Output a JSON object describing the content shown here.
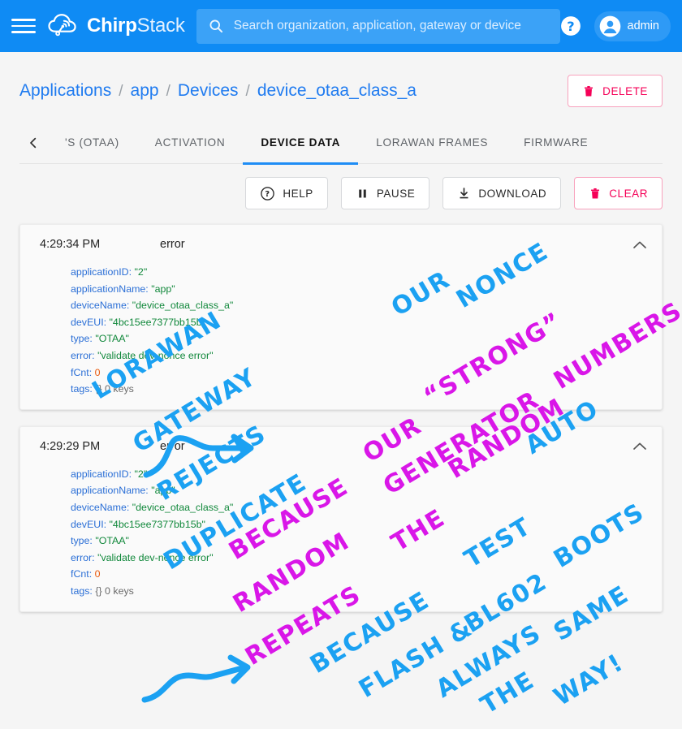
{
  "header": {
    "menu_icon": "hamburger-icon",
    "brand_bold": "Chirp",
    "brand_thin": "Stack",
    "logo_icon": "chirpstack-cloud-icon",
    "search_icon": "search-icon",
    "search_value": "",
    "search_placeholder": "Search organization, application, gateway or device",
    "help_icon": "help-circle-icon",
    "avatar_icon": "account-circle-icon",
    "user_name": "admin",
    "bg_color": "#0f8bf4"
  },
  "breadcrumb": {
    "items": [
      {
        "label": "Applications"
      },
      {
        "label": "app"
      },
      {
        "label": "Devices"
      },
      {
        "label": "device_otaa_class_a"
      }
    ],
    "separator": "/",
    "link_color": "#1f7bf0"
  },
  "delete_button": {
    "label": "DELETE",
    "icon": "trash-icon",
    "color": "#f50057"
  },
  "tabs": {
    "back_icon": "chevron-left-icon",
    "items": [
      {
        "label": "'S (OTAA)",
        "active": false
      },
      {
        "label": "ACTIVATION",
        "active": false
      },
      {
        "label": "DEVICE DATA",
        "active": true
      },
      {
        "label": "LORAWAN FRAMES",
        "active": false
      },
      {
        "label": "FIRMWARE",
        "active": false
      }
    ],
    "active_color": "#1f8df5"
  },
  "toolbar": {
    "buttons": [
      {
        "label": "HELP",
        "icon": "help-circle-icon",
        "danger": false
      },
      {
        "label": "PAUSE",
        "icon": "pause-icon",
        "danger": false
      },
      {
        "label": "DOWNLOAD",
        "icon": "download-icon",
        "danger": false
      },
      {
        "label": "CLEAR",
        "icon": "trash-icon",
        "danger": true
      }
    ]
  },
  "events": [
    {
      "time": "4:29:34 PM",
      "kind": "error",
      "collapse_icon": "chevron-up-icon",
      "fields": [
        {
          "key": "applicationID:",
          "value": "\"2\"",
          "type": "string"
        },
        {
          "key": "applicationName:",
          "value": "\"app\"",
          "type": "string"
        },
        {
          "key": "deviceName:",
          "value": "\"device_otaa_class_a\"",
          "type": "string"
        },
        {
          "key": "devEUI:",
          "value": "\"4bc15ee7377bb15b\"",
          "type": "string"
        },
        {
          "key": "type:",
          "value": "\"OTAA\"",
          "type": "string"
        },
        {
          "key": "error:",
          "value": "\"validate dev-nonce error\"",
          "type": "string"
        },
        {
          "key": "fCnt:",
          "value": "0",
          "type": "number"
        },
        {
          "key": "tags:",
          "value": "{}  0 keys",
          "type": "dim"
        }
      ]
    },
    {
      "time": "4:29:29 PM",
      "kind": "error",
      "collapse_icon": "chevron-up-icon",
      "fields": [
        {
          "key": "applicationID:",
          "value": "\"2\"",
          "type": "string"
        },
        {
          "key": "applicationName:",
          "value": "\"app\"",
          "type": "string"
        },
        {
          "key": "deviceName:",
          "value": "\"device_otaa_class_a\"",
          "type": "string"
        },
        {
          "key": "devEUI:",
          "value": "\"4bc15ee7377bb15b\"",
          "type": "string"
        },
        {
          "key": "type:",
          "value": "\"OTAA\"",
          "type": "string"
        },
        {
          "key": "error:",
          "value": "\"validate dev-nonce error\"",
          "type": "string"
        },
        {
          "key": "fCnt:",
          "value": "0",
          "type": "number"
        },
        {
          "key": "tags:",
          "value": "{}  0 keys",
          "type": "dim"
        }
      ]
    }
  ],
  "annotations": {
    "blue_color": "#1ba1f2",
    "magenta_color": "#d916e8",
    "words_blue": [
      "LORAWAN",
      "GATEWAY",
      "REJECTS",
      "DUPLICATE",
      "OUR",
      "NONCE",
      "AUTO",
      "BECAUSE",
      "FLASH",
      "&",
      "TEST",
      "BL602",
      "ALWAYS",
      "BOOTS",
      "THE",
      "SAME",
      "WAY!"
    ],
    "words_magenta": [
      "\"STRONG\"",
      "OUR",
      "GENERATOR",
      "RANDOM",
      "NUMBERS",
      "BECAUSE",
      "RANDOM",
      "REPEATS",
      "THE"
    ],
    "phrase_blue_top": "LORAWAN GATEWAY REJECTS OUR DUPLICATE NONCE",
    "phrase_magenta_top": "OUR \"STRONG\" RANDOM NUMBERS GENERATOR AUTO",
    "phrase_magenta_bottom": "BECAUSE THE RANDOM REPEATS",
    "phrase_blue_bottom": "BECAUSE FLASH & TEST BL602 ALWAYS BOOTS THE SAME WAY!"
  }
}
